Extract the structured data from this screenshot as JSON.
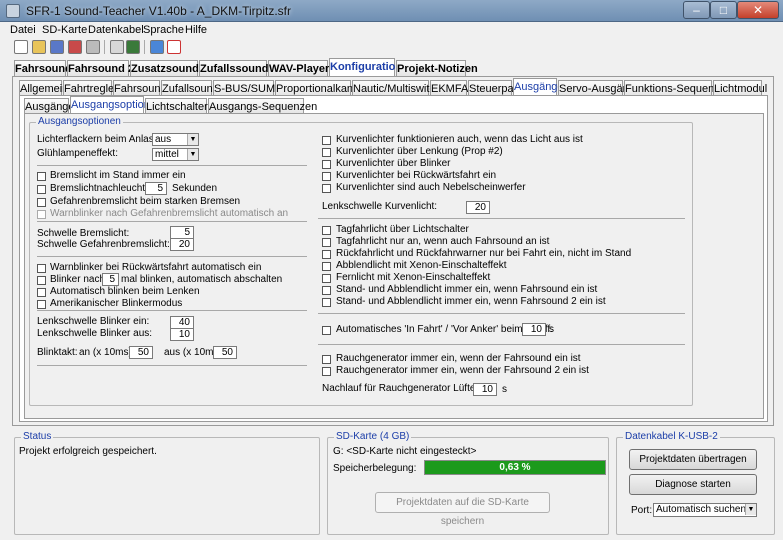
{
  "window": {
    "title": "SFR-1 Sound-Teacher V1.40b - A_DKM-Tirpitz.sfr",
    "min": "–",
    "max": "□",
    "close": "✕"
  },
  "menu": [
    "Datei",
    "SD-Karte",
    "Datenkabel",
    "Sprache",
    "Hilfe"
  ],
  "toolbar_icons": [
    "new-file-icon",
    "open-folder-icon",
    "save-icon",
    "save-as-icon",
    "print-icon",
    "chart-icon",
    "connect-icon",
    "music-note-icon",
    "export-icon"
  ],
  "tabs_main": [
    "Fahrsound",
    "Fahrsound 2",
    "Zusatzsounds",
    "Zufallssounds",
    "WAV-Player",
    "Konfiguration",
    "Projekt-Notizen"
  ],
  "tabs_sub": [
    "Allgemein",
    "Fahrtregler",
    "Fahrsound",
    "Zufallsound",
    "S-BUS/SUMD",
    "Proportionalkanäle",
    "Nautic/Multiswitch",
    "EKMFA",
    "Steuerpad",
    "Ausgänge",
    "Servo-Ausgänge",
    "Funktions-Sequenzen",
    "Lichtmodul"
  ],
  "tabs_third": [
    "Ausgänge",
    "Ausgangsoptionen",
    "Lichtschalter",
    "Ausgangs-Sequenzen"
  ],
  "group_title": "Ausgangsoptionen",
  "left": {
    "lichterflackern_label": "Lichterflackern beim Anlassen:",
    "lichterflackern_value": "aus",
    "gluehlampen_label": "Glühlampeneffekt:",
    "gluehlampen_value": "mittel",
    "brems_stand": "Bremslicht im Stand immer ein",
    "brems_nach": "Bremslichtnachleuchten:",
    "brems_nach_value": "5",
    "brems_nach_unit": "Sekunden",
    "gefahren_brems": "Gefahrenbremslicht beim starken Bremsen",
    "warn_gefahren": "Warnblinker nach Gefahrenbremslicht automatisch an",
    "schwelle_brems_label": "Schwelle Bremslicht:",
    "schwelle_brems_value": "5",
    "schwelle_gefahren_label": "Schwelle Gefahrenbremslicht:",
    "schwelle_gefahren_value": "20",
    "warn_rueck": "Warnblinker bei Rückwärtsfahrt automatisch ein",
    "blinker_nach_a": "Blinker nach",
    "blinker_nach_value": "5",
    "blinker_nach_b": "mal blinken, automatisch abschalten",
    "auto_lenken": "Automatisch blinken beim Lenken",
    "amerik": "Amerikanischer Blinkermodus",
    "lenk_ein_label": "Lenkschwelle Blinker ein:",
    "lenk_ein_value": "40",
    "lenk_aus_label": "Lenkschwelle Blinker aus:",
    "lenk_aus_value": "10",
    "blinktakt_label": "Blinktakt:",
    "an_label": "an (x 10ms):",
    "an_value": "50",
    "aus_label": "aus (x 10ms):",
    "aus_value": "50"
  },
  "right": {
    "kurv1": "Kurvenlichter funktionieren auch, wenn das Licht aus ist",
    "kurv2": "Kurvenlichter über Lenkung (Prop #2)",
    "kurv3": "Kurvenlichter über Blinker",
    "kurv4": "Kurvenlichter bei Rückwärtsfahrt ein",
    "kurv5": "Kurvenlichter sind auch Nebelscheinwerfer",
    "lenk_kurv_label": "Lenkschwelle Kurvenlicht:",
    "lenk_kurv_value": "20",
    "tag1": "Tagfahrlicht über Lichtschalter",
    "tag2": "Tagfahrlicht nur an, wenn auch Fahrsound an ist",
    "rueck": "Rückfahrlicht und Rückfahrwarner nur bei Fahrt ein, nicht im Stand",
    "abblend": "Abblendlicht mit Xenon-Einschalteffekt",
    "fern": "Fernlicht mit Xenon-Einschalteffekt",
    "stand1": "Stand- und Abblendlicht immer ein, wenn Fahrsound ein ist",
    "stand2": "Stand- und Abblendlicht immer ein, wenn Fahrsound 2 ein ist",
    "anker_label": "Automatisches 'In Fahrt' / 'Vor Anker' beim Schiff:",
    "anker_value": "10",
    "anker_unit": "s",
    "rauch1": "Rauchgenerator immer ein, wenn der Fahrsound ein ist",
    "rauch2": "Rauchgenerator immer ein, wenn der Fahrsound 2 ein ist",
    "nachlauf_label": "Nachlauf für Rauchgenerator Lüfter:",
    "nachlauf_value": "10",
    "nachlauf_unit": "s"
  },
  "status": {
    "title": "Status",
    "text": "Projekt erfolgreich gespeichert."
  },
  "sd": {
    "title": "SD-Karte (4 GB)",
    "card": "G: <SD-Karte nicht eingesteckt>",
    "usage_label": "Speicherbelegung:",
    "usage_text": "0,63 %",
    "usage_percent": 0.63,
    "save_button": "Projektdaten auf die SD-Karte speichern"
  },
  "cable": {
    "title": "Datenkabel K-USB-2",
    "transfer_button": "Projektdaten übertragen",
    "diag_button": "Diagnose starten",
    "port_label": "Port:",
    "port_value": "Automatisch suchen"
  },
  "colors": {
    "accent": "#1c3ea8",
    "progress": "#1c9a1c"
  }
}
